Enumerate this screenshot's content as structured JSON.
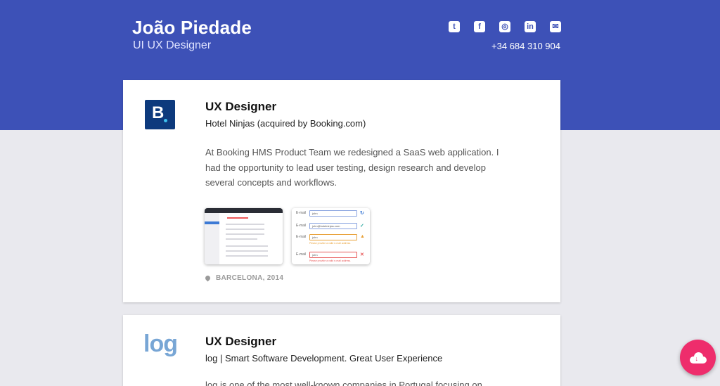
{
  "header": {
    "name": "João Piedade",
    "role": "UI UX Designer",
    "phone": "+34 684 310 904",
    "socials": [
      {
        "icon": "twitter-icon",
        "glyph": "t"
      },
      {
        "icon": "facebook-icon",
        "glyph": "f"
      },
      {
        "icon": "instagram-icon",
        "glyph": "◎"
      },
      {
        "icon": "linkedin-icon",
        "glyph": "in"
      },
      {
        "icon": "mail-icon",
        "glyph": "✉"
      }
    ],
    "bg_color": "#3d51b7"
  },
  "jobs": [
    {
      "logo_text": "B",
      "title": "UX Designer",
      "company": "Hotel Ninjas (acquired by Booking.com)",
      "description": "At Booking HMS Product Team we redesigned a SaaS web application. I had the opportunity to lead user testing, design research and develop several concepts and workflows.",
      "location": "BARCELONA, 2014",
      "thumbnail_form": {
        "label": "E-mail",
        "values": [
          "john",
          "john@hotelninjas.com",
          "john",
          "john"
        ],
        "errors": [
          "Please provide a valid e-mail address.",
          "Please provide a valid e-mail address."
        ]
      }
    },
    {
      "logo_text": "log",
      "title": "UX Designer",
      "company": "log | Smart Software Development. Great User Experience",
      "description": "log is one of the most well-known companies in Portugal focusing on"
    }
  ],
  "fab": {
    "icon": "cloud-download-icon",
    "color": "#ee2d6c"
  }
}
